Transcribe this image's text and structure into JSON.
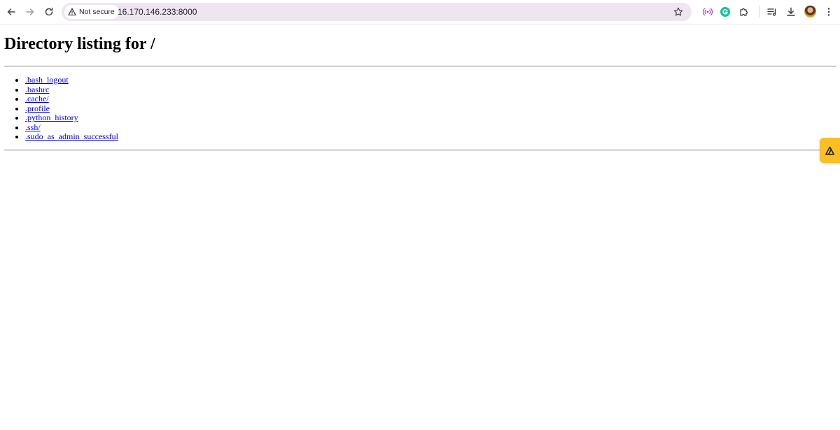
{
  "browser": {
    "security_label": "Not secure",
    "url": "16.170.146.233:8000",
    "icons": {
      "back": "arrow-left-icon",
      "forward": "arrow-right-icon",
      "reload": "reload-icon",
      "security": "warning-triangle-icon",
      "bookmark": "star-icon",
      "cast": "broadcast-icon",
      "grammarly": "grammarly-icon",
      "extensions": "puzzle-icon",
      "reading_list": "reading-list-icon",
      "downloads": "download-icon",
      "profile": "avatar",
      "menu": "kebab-menu-icon"
    },
    "colors": {
      "omnibox_bg": "#efe5f1",
      "link": "#0000ee",
      "side_widget": "#fbbf24",
      "grammarly": "#15c39a"
    }
  },
  "page": {
    "title": "Directory listing for /",
    "entries": [
      ".bash_logout",
      ".bashrc",
      ".cache/",
      ".profile",
      ".python_history",
      ".ssh/",
      ".sudo_as_admin_successful"
    ]
  },
  "side_widget": {
    "icon": "triangle-logo-icon"
  }
}
